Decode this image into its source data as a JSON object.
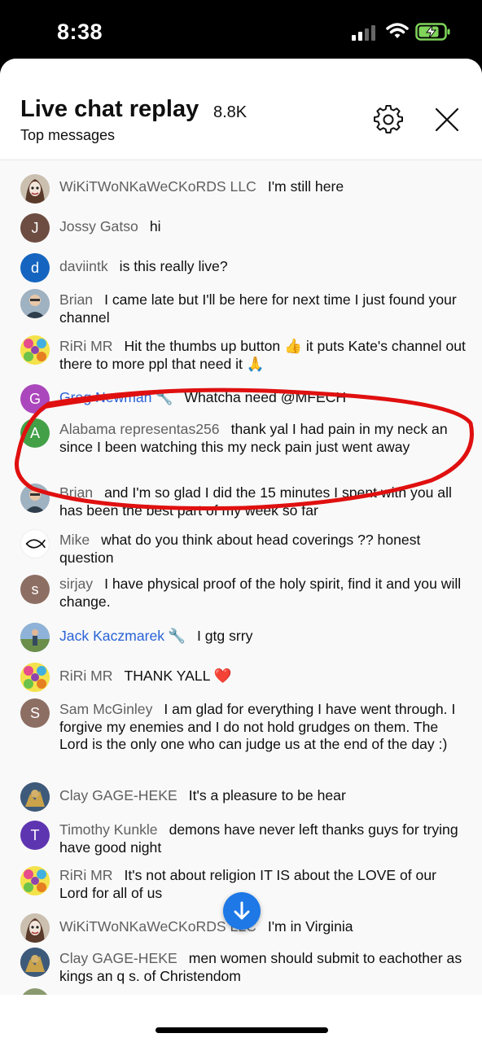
{
  "status": {
    "time": "8:38",
    "icons": [
      "cellular-signal-icon",
      "wifi-icon",
      "battery-charging-icon"
    ]
  },
  "header": {
    "title": "Live chat replay",
    "count": "8.8K",
    "subtitle": "Top messages",
    "settings_icon": "gear-icon",
    "close_icon": "close-icon"
  },
  "messages": [
    {
      "author": "WiKiTWoNKaWeCKoRDS LLC",
      "text": "I'm still here",
      "avatar": "photo"
    },
    {
      "author": "Jossy Gatso",
      "text": "hi",
      "avatar": "J",
      "color": "#6d4c41"
    },
    {
      "author": "daviintk",
      "text": "is this really live?",
      "avatar": "d",
      "color": "#1565c0"
    },
    {
      "author": "Brian",
      "text": "I came late but I'll be here for next time I just found your channel",
      "avatar": "photo"
    },
    {
      "author": "RiRi MR",
      "text": "Hit the thumbs up button 👍 it puts Kate's channel out there to more ppl that need it 🙏",
      "avatar": "photo"
    },
    {
      "author": "Greg Newman",
      "text": "Whatcha need @MFECH",
      "avatar": "G",
      "color": "#ab47bc",
      "moderator": true
    },
    {
      "author": "Alabama representas256",
      "text": "thank yal I had pain in my neck an since I been watching this my neck pain just went away",
      "avatar": "A",
      "color": "#43a047"
    },
    {
      "author": "Brian",
      "text": "and I'm so glad I did the 15 minutes I spent with you all has been the best part of my week so far",
      "avatar": "photo"
    },
    {
      "author": "Mike",
      "text": "what do you think about head coverings ?? honest question",
      "avatar": "fish"
    },
    {
      "author": "sirjay",
      "text": "I have physical proof of the holy spirit, find it and you will change.",
      "avatar": "s",
      "color": "#8d6e63"
    },
    {
      "author": "Jack Kaczmarek",
      "text": "I gtg srry",
      "avatar": "photo",
      "moderator": true
    },
    {
      "author": "RiRi MR",
      "text": "THANK YALL ❤️",
      "avatar": "photo"
    },
    {
      "author": "Sam McGinley",
      "text": "I am glad for everything I have went through. I forgive my enemies and I do not hold grudges on them. The Lord is the only one who can judge us at the end of the day :)",
      "avatar": "S",
      "color": "#8d6e63"
    },
    {
      "author": "Clay GAGE-HEKE",
      "text": "It's a pleasure to be hear",
      "avatar": "photo"
    },
    {
      "author": "Timothy Kunkle",
      "text": "demons have never left thanks guys for trying have good night",
      "avatar": "T",
      "color": "#5e35b1"
    },
    {
      "author": "RiRi MR",
      "text": "It's not about religion IT IS about the LOVE of our Lord for all of us",
      "avatar": "photo"
    },
    {
      "author": "WiKiTWoNKaWeCKoRDS LLC",
      "text": "I'm in Virginia",
      "avatar": "photo"
    },
    {
      "author": "Clay GAGE-HEKE",
      "text": "men women should submit to eachother as kings an q s. of Christendom",
      "avatar": "photo"
    }
  ],
  "scroll_button_icon": "arrow-down-icon",
  "annotation_color": "#e01010"
}
